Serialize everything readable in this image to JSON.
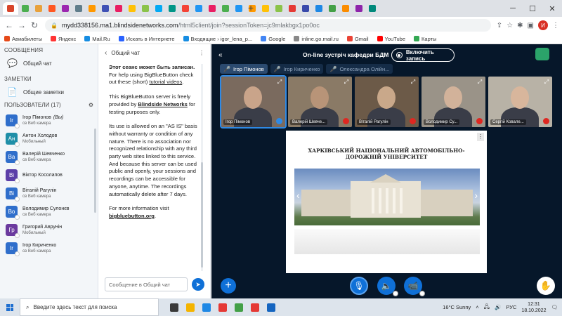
{
  "browser": {
    "tabs": [
      {
        "color": "#d8452b"
      },
      {
        "color": "#4caf50"
      },
      {
        "color": "#e8a13b"
      },
      {
        "color": "#ff5722"
      },
      {
        "color": "#9c27b0"
      },
      {
        "color": "#607d8b"
      },
      {
        "color": "#ff9800"
      },
      {
        "color": "#3f51b5"
      },
      {
        "color": "#e91e63"
      },
      {
        "color": "#ffc107"
      },
      {
        "color": "#8bc34a"
      },
      {
        "color": "#03a9f4"
      },
      {
        "color": "#009688"
      },
      {
        "color": "#f44336"
      },
      {
        "color": "#2196f3"
      },
      {
        "color": "#e91e63"
      },
      {
        "color": "#4caf50"
      },
      {
        "color": "#2196f3"
      },
      {
        "color": "#ff9800"
      },
      {
        "color": "#ffc107"
      },
      {
        "color": "#8bc34a"
      },
      {
        "color": "#e53935"
      },
      {
        "color": "#3949ab"
      },
      {
        "color": "#1e88e5"
      },
      {
        "color": "#43a047"
      },
      {
        "color": "#fb8c00"
      },
      {
        "color": "#8e24aa"
      },
      {
        "color": "#00897b"
      }
    ],
    "new_tab": "+",
    "url_host": "mydd338156.ma1.blindsidenetworks.com",
    "url_path": "/html5client/join?sessionToken=jc9mlakbgx1po0oc",
    "profile_initial": "И",
    "bookmarks": [
      {
        "label": "Авиабилеты",
        "color": "#e64a19"
      },
      {
        "label": "Яндекс",
        "color": "#ff3333"
      },
      {
        "label": "Mail.Ru",
        "color": "#168de2"
      },
      {
        "label": "Искать в Интернете",
        "color": "#2962ff"
      },
      {
        "label": "Входящие › igor_lena_p...",
        "color": "#168de2"
      },
      {
        "label": "Google",
        "color": "#4285f4"
      },
      {
        "label": "inline.go.mail.ru",
        "color": "#888888"
      },
      {
        "label": "Gmail",
        "color": "#ea4335"
      },
      {
        "label": "YouTube",
        "color": "#ff0000"
      },
      {
        "label": "Карты",
        "color": "#34a853"
      }
    ]
  },
  "sidebar": {
    "messages_header": "СООБЩЕНИЯ",
    "public_chat": "Общий чат",
    "notes_header": "ЗАМЕТКИ",
    "shared_notes": "Общие заметки",
    "users_header": "ПОЛЬЗОВАТЕЛИ (17)",
    "users": [
      {
        "initials": "Ir",
        "name": "Ігор Пімонов",
        "you": "(Вы)",
        "status": "св Веб камера",
        "color": "#2f6ecb"
      },
      {
        "initials": "Ан",
        "name": "Антон Холодов",
        "you": "",
        "status": "Мобильный",
        "color": "#1f8fa8"
      },
      {
        "initials": "Ва",
        "name": "Валерій Шевченко",
        "you": "",
        "status": "св Веб камера",
        "color": "#2f6ecb"
      },
      {
        "initials": "Ві",
        "name": "Віктор Косолапов",
        "you": "",
        "status": "",
        "color": "#5b3ea8"
      },
      {
        "initials": "Ві",
        "name": "Віталій Рагулін",
        "you": "",
        "status": "св Веб камера",
        "color": "#2f6ecb"
      },
      {
        "initials": "Во",
        "name": "Володимир Сулонєв",
        "you": "",
        "status": "св Веб камера",
        "color": "#2f6ecb"
      },
      {
        "initials": "Гр",
        "name": "Григорий Аврунін",
        "you": "",
        "status": "Мобильный",
        "color": "#6b3a9e"
      },
      {
        "initials": "Ir",
        "name": "Ігор Кириченко",
        "you": "",
        "status": "св Веб камера",
        "color": "#2f6ecb"
      }
    ]
  },
  "chat": {
    "title": "Общий чат",
    "p1_bold": "Этот сеанс может быть записан.",
    "p1_rest": " For help using BigBlueButton check out these (short) ",
    "p1_link": "tutorial videos",
    "p1_end": ".",
    "p2_start": "This BigBlueButton server is freely provided by ",
    "p2_link": "Blindside Networks",
    "p2_end": " for testing purposes only.",
    "p3": "Its use is allowed on an \"AS IS\" basis without warranty or condition of any nature. There is no association nor recognized relationship with any third party web sites linked to this service. And because this server can be used public and openly, your sessions and recordings can be accessible for anyone, anytime. The recordings automatically delete after 7 days.",
    "p4_start": "For more information visit ",
    "p4_link": "bigbluebutton.org",
    "p4_end": ".",
    "placeholder": "Сообщение в Общий чат"
  },
  "meeting": {
    "title": "On-line зустріч кафедри БДМ",
    "record_label": "Включить запись",
    "talking": [
      {
        "name": "Ігор Пімонов",
        "active": true
      },
      {
        "name": "Ігор Кириченко",
        "active": false
      },
      {
        "name": "Олександра Олійн...",
        "active": false
      }
    ],
    "videos": [
      {
        "name": "Ігор Пімонов",
        "bg": "#7a6a5e",
        "face": "#c9a48a",
        "active": true
      },
      {
        "name": "Валерій Шевче...",
        "bg": "#8a7a66",
        "face": "#b89478",
        "active": false
      },
      {
        "name": "Віталій Рагулін",
        "bg": "#6c5a48",
        "face": "#c9a88a",
        "active": false
      },
      {
        "name": "Володимир Су...",
        "bg": "#9a9388",
        "face": "#d2b29a",
        "active": false
      },
      {
        "name": "Сергій Ковале...",
        "bg": "#b8b2a6",
        "face": "#d8b69c",
        "active": false
      }
    ],
    "slide_title": "ХАРКІВСЬКИЙ НАЦІОНАЛЬНИЙ АВТОМОБІЛЬНО-ДОРОЖНІЙ УНІВЕРСИТЕТ",
    "colors": {
      "accent": "#0f70d7",
      "bg": "#06172a",
      "record_off": "#df2721"
    }
  },
  "taskbar": {
    "search_placeholder": "Введите здесь текст для поиска",
    "weather": "16°C  Sunny",
    "lang": "РУС",
    "time": "12:31",
    "date": "18.10.2022",
    "apps": [
      {
        "color": "#3a3a3a"
      },
      {
        "color": "#f4b400"
      },
      {
        "color": "#1e88e5"
      },
      {
        "color": "#e53935"
      },
      {
        "color": "#43a047"
      },
      {
        "color": "#e53935"
      },
      {
        "color": "#1565c0"
      }
    ]
  }
}
